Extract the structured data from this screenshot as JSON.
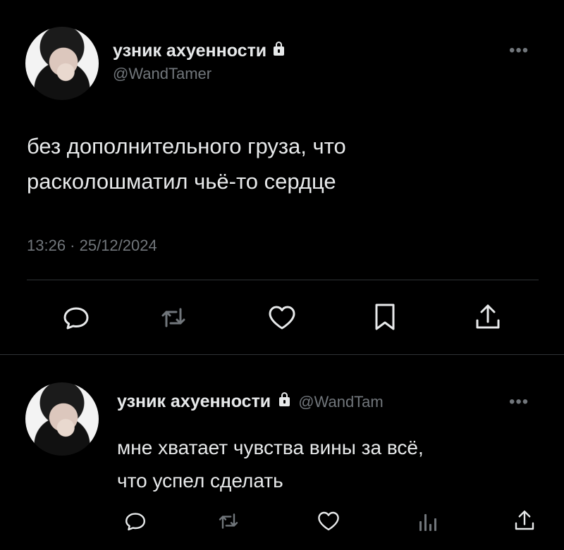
{
  "main_tweet": {
    "author_name": "узник ахуенности",
    "handle": "@WandTamer",
    "text_line1": "без дополнительного груза, что",
    "text_line2": "расколошматил чьё-то сердце",
    "timestamp": "13:26 · 25/12/2024",
    "actions": [
      "reply-icon",
      "retweet-icon",
      "like-icon",
      "bookmark-icon",
      "share-icon"
    ]
  },
  "reply_tweet": {
    "author_name": "узник ахуенности",
    "handle": "@WandTam",
    "text_line1": "мне хватает чувства вины за всё,",
    "text_line2": "что успел сделать",
    "actions": [
      "reply-icon",
      "retweet-icon",
      "like-icon",
      "views-icon",
      "share-icon"
    ]
  },
  "more_label": "•••",
  "colors": {
    "background": "#000000",
    "text": "#e7e9ea",
    "muted": "#71767b",
    "divider": "#2f3336"
  }
}
